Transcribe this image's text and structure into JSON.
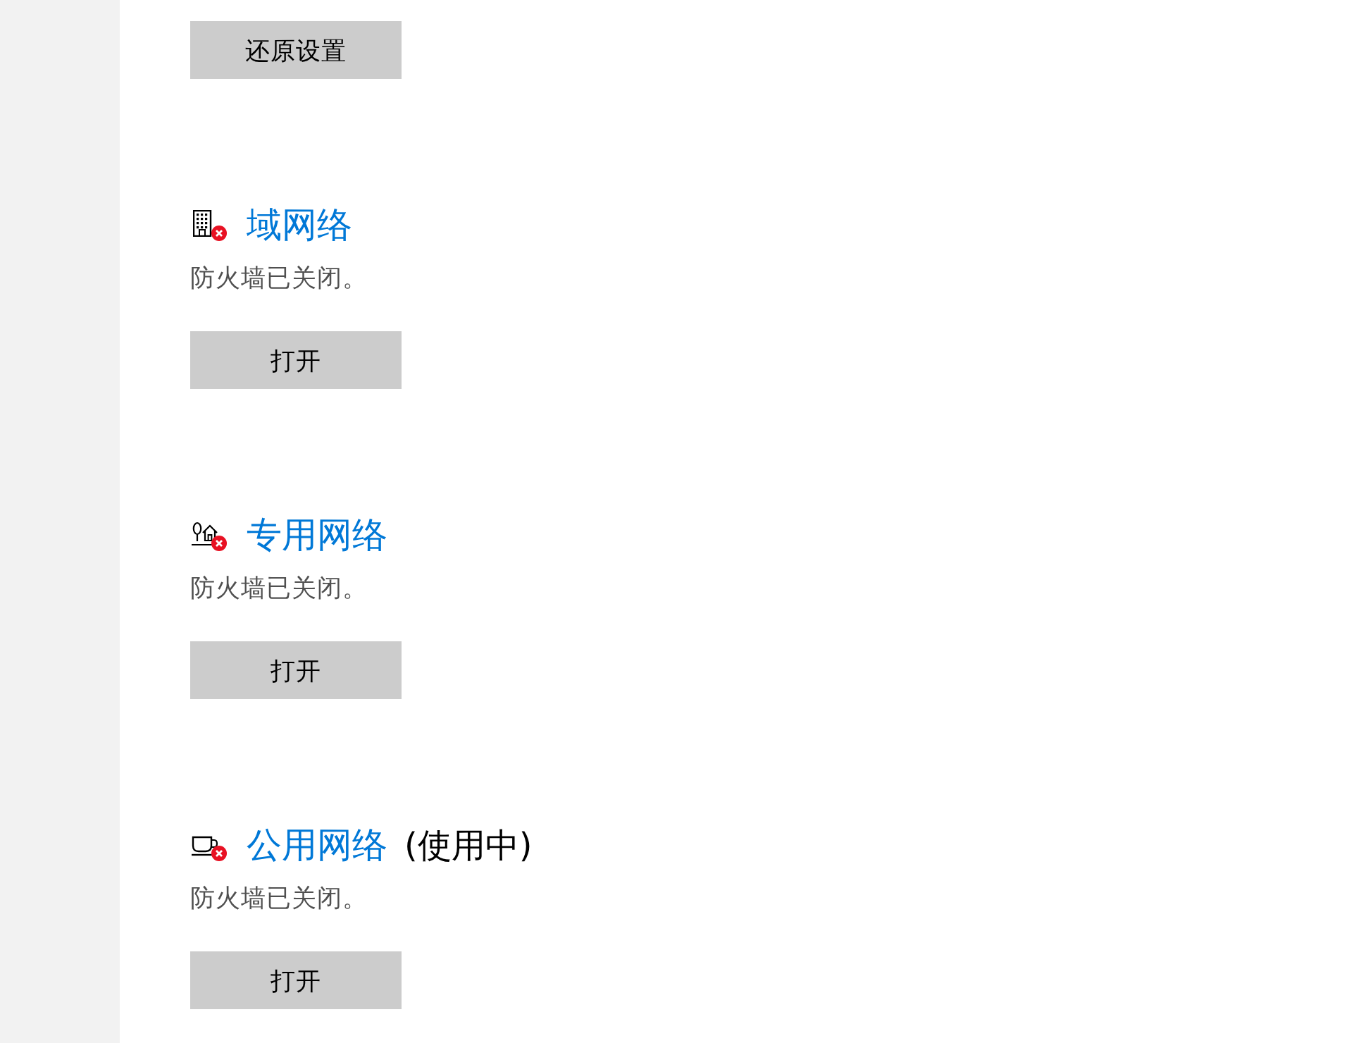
{
  "reset_button": {
    "label": "还原设置"
  },
  "networks": [
    {
      "kind": "domain",
      "name": "域网络",
      "firewall_on": false,
      "status": "防火墙已关闭。",
      "button": "打开"
    },
    {
      "kind": "private",
      "name": "专用网络",
      "firewall_on": false,
      "status": "防火墙已关闭。",
      "button": "打开"
    },
    {
      "kind": "public",
      "name": "公用网络",
      "note": "(使用中)",
      "firewall_on": false,
      "status": "防火墙已关闭。",
      "button": "打开"
    }
  ]
}
